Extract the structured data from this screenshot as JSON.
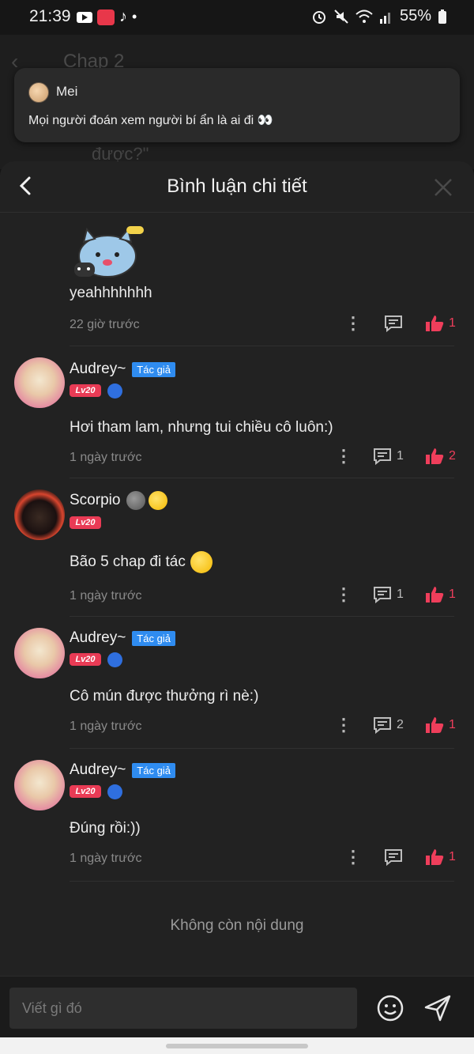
{
  "status_bar": {
    "time": "21:39",
    "battery": "55%"
  },
  "background": {
    "title": "Chap 2",
    "partial_text": "được?\""
  },
  "notification": {
    "name": "Mei",
    "message": "Mọi người đoán xem người bí ẩn là ai đi 👀"
  },
  "sheet": {
    "title": "Bình luận chi tiết"
  },
  "comments": [
    {
      "text": "yeahhhhhhh",
      "time": "22 giờ trước",
      "likes": "1"
    },
    {
      "name": "Audrey~",
      "badge": "Tác giả",
      "level": "Lv20",
      "text": "Hơi tham lam, nhưng tui chiều cô luôn:)",
      "time": "1 ngày trước",
      "replies": "1",
      "likes": "2"
    },
    {
      "name": "Scorpio",
      "level": "Lv20",
      "text": "Bão 5 chap đi tác",
      "time": "1 ngày trước",
      "replies": "1",
      "likes": "1"
    },
    {
      "name": "Audrey~",
      "badge": "Tác giả",
      "level": "Lv20",
      "text": "Cô mún được thưởng rì nè:)",
      "time": "1 ngày trước",
      "replies": "2",
      "likes": "1"
    },
    {
      "name": "Audrey~",
      "badge": "Tác giả",
      "level": "Lv20",
      "text": "Đúng rồi:))",
      "time": "1 ngày trước",
      "likes": "1"
    }
  ],
  "footer": {
    "no_more": "Không còn nội dung"
  },
  "composer": {
    "placeholder": "Viết gì đó"
  },
  "colors": {
    "like": "#ef3e5b",
    "author_badge": "#2f8cf0",
    "level_badge": "#e93b55",
    "background": "#222222"
  }
}
